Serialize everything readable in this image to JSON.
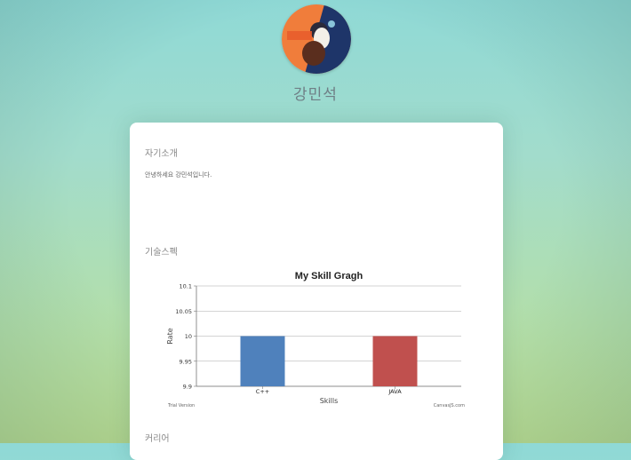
{
  "profile": {
    "name": "강민석",
    "avatar_colors": [
      "#f07d3b",
      "#1e3569"
    ]
  },
  "sections": {
    "intro_title": "자기소개",
    "intro_text": "안녕하세요 강민석입니다.",
    "skills_title": "기술스펙",
    "career_title": "커리어"
  },
  "chart_data": {
    "type": "bar",
    "title": "My Skill Gragh",
    "xlabel": "Skills",
    "ylabel": "Rate",
    "categories": [
      "C++",
      "JAVA"
    ],
    "values": [
      10,
      10
    ],
    "colors": [
      "#4f81bc",
      "#c0504e"
    ],
    "ylim": [
      9.9,
      10.1
    ],
    "yticks": [
      "9.9",
      "9.95",
      "10",
      "10.05",
      "10.1"
    ],
    "grid": true,
    "watermark_left": "Trial Version",
    "watermark_right": "CanvasJS.com"
  }
}
